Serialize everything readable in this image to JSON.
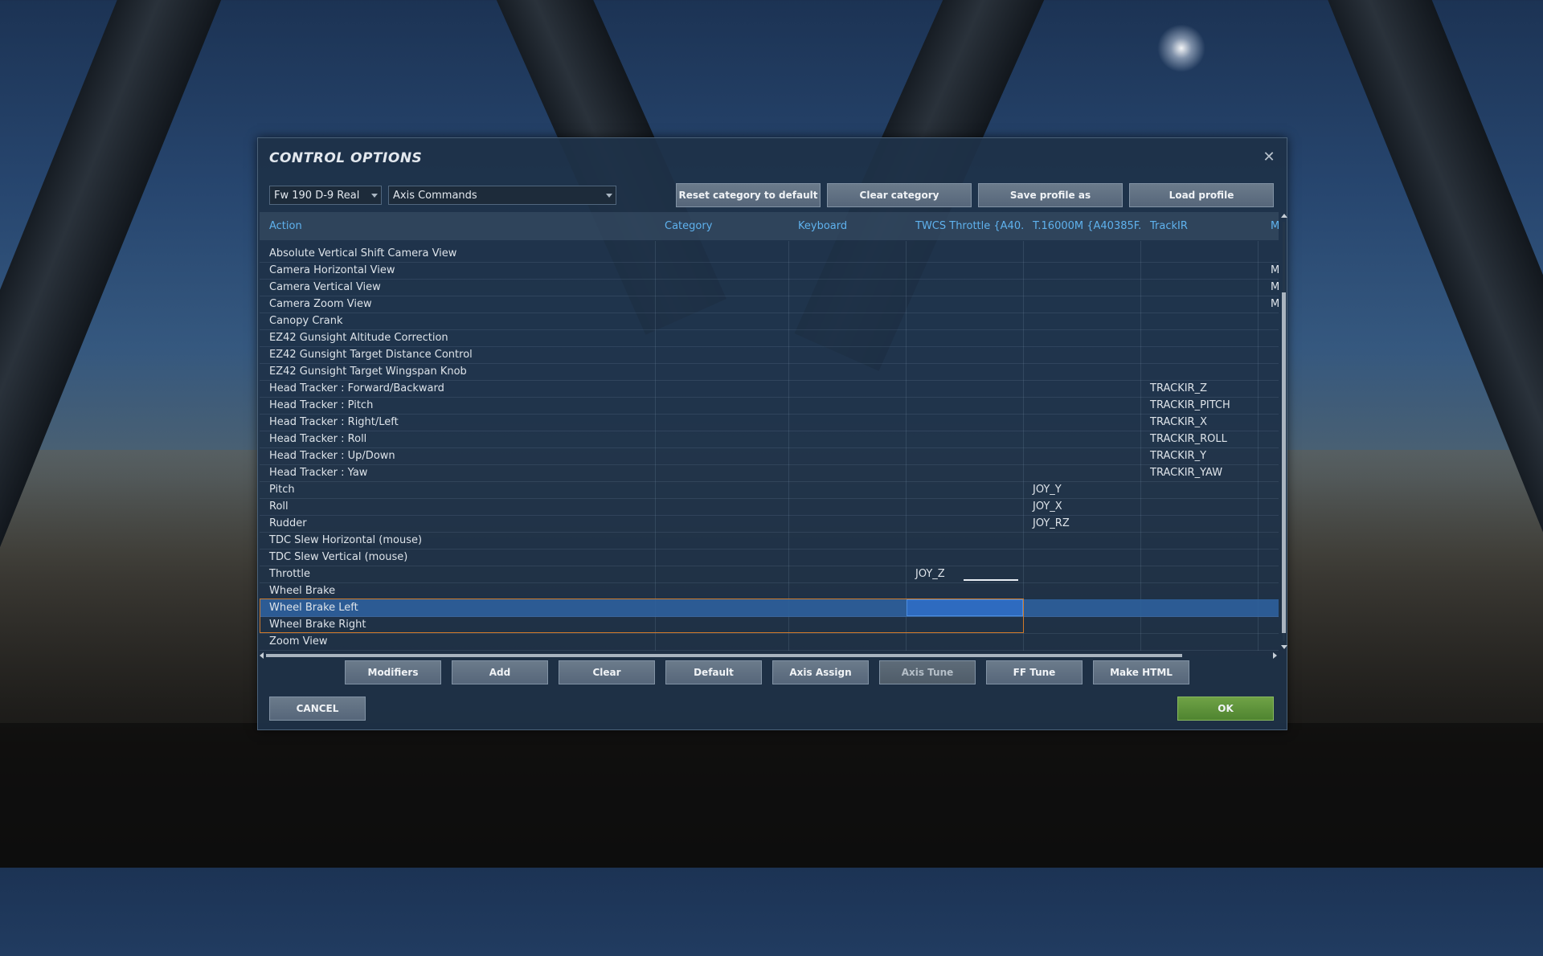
{
  "dialog": {
    "title": "CONTROL OPTIONS",
    "close_icon": "close-icon"
  },
  "selectors": {
    "aircraft": "Fw 190 D-9 Real",
    "category": "Axis Commands"
  },
  "top_buttons": {
    "reset": "Reset category to default",
    "clear_category": "Clear category",
    "save_profile": "Save profile as",
    "load_profile": "Load profile"
  },
  "columns": {
    "action": "Action",
    "category": "Category",
    "keyboard": "Keyboard",
    "twcs": "TWCS Throttle {A40...",
    "t16000m": "T.16000M {A40385F...",
    "trackir": "TrackIR",
    "more": "M"
  },
  "rows": [
    {
      "action": "Absolute Vertical Shift Camera View",
      "twcs": "",
      "t16000m": "",
      "trackir": "",
      "more": ""
    },
    {
      "action": "Camera Horizontal View",
      "twcs": "",
      "t16000m": "",
      "trackir": "",
      "more": "M"
    },
    {
      "action": "Camera Vertical View",
      "twcs": "",
      "t16000m": "",
      "trackir": "",
      "more": "M"
    },
    {
      "action": "Camera Zoom View",
      "twcs": "",
      "t16000m": "",
      "trackir": "",
      "more": "M"
    },
    {
      "action": "Canopy Crank",
      "twcs": "",
      "t16000m": "",
      "trackir": "",
      "more": ""
    },
    {
      "action": "EZ42 Gunsight Altitude Correction",
      "twcs": "",
      "t16000m": "",
      "trackir": "",
      "more": ""
    },
    {
      "action": "EZ42 Gunsight Target Distance Control",
      "twcs": "",
      "t16000m": "",
      "trackir": "",
      "more": ""
    },
    {
      "action": "EZ42 Gunsight Target Wingspan Knob",
      "twcs": "",
      "t16000m": "",
      "trackir": "",
      "more": ""
    },
    {
      "action": "Head Tracker : Forward/Backward",
      "twcs": "",
      "t16000m": "",
      "trackir": "TRACKIR_Z",
      "more": ""
    },
    {
      "action": "Head Tracker : Pitch",
      "twcs": "",
      "t16000m": "",
      "trackir": "TRACKIR_PITCH",
      "more": ""
    },
    {
      "action": "Head Tracker : Right/Left",
      "twcs": "",
      "t16000m": "",
      "trackir": "TRACKIR_X",
      "more": ""
    },
    {
      "action": "Head Tracker : Roll",
      "twcs": "",
      "t16000m": "",
      "trackir": "TRACKIR_ROLL",
      "more": ""
    },
    {
      "action": "Head Tracker : Up/Down",
      "twcs": "",
      "t16000m": "",
      "trackir": "TRACKIR_Y",
      "more": ""
    },
    {
      "action": "Head Tracker : Yaw",
      "twcs": "",
      "t16000m": "",
      "trackir": "TRACKIR_YAW",
      "more": ""
    },
    {
      "action": "Pitch",
      "twcs": "",
      "t16000m": "JOY_Y",
      "trackir": "",
      "more": ""
    },
    {
      "action": "Roll",
      "twcs": "",
      "t16000m": "JOY_X",
      "trackir": "",
      "more": ""
    },
    {
      "action": "Rudder",
      "twcs": "",
      "t16000m": "JOY_RZ",
      "trackir": "",
      "more": ""
    },
    {
      "action": "TDC Slew Horizontal (mouse)",
      "twcs": "",
      "t16000m": "",
      "trackir": "",
      "more": ""
    },
    {
      "action": "TDC Slew Vertical (mouse)",
      "twcs": "",
      "t16000m": "",
      "trackir": "",
      "more": ""
    },
    {
      "action": "Throttle",
      "twcs": "JOY_Z",
      "t16000m": "",
      "trackir": "",
      "more": ""
    },
    {
      "action": "Wheel Brake",
      "twcs": "",
      "t16000m": "",
      "trackir": "",
      "more": ""
    },
    {
      "action": "Wheel Brake Left",
      "twcs": "",
      "t16000m": "",
      "trackir": "",
      "more": ""
    },
    {
      "action": "Wheel Brake Right",
      "twcs": "",
      "t16000m": "",
      "trackir": "",
      "more": ""
    },
    {
      "action": "Zoom View",
      "twcs": "",
      "t16000m": "",
      "trackir": "",
      "more": ""
    }
  ],
  "selected_row": "Wheel Brake Left",
  "bottom_buttons": {
    "modifiers": "Modifiers",
    "add": "Add",
    "clear": "Clear",
    "default": "Default",
    "axis_assign": "Axis Assign",
    "axis_tune": "Axis Tune",
    "ff_tune": "FF Tune",
    "make_html": "Make HTML"
  },
  "footer": {
    "cancel": "CANCEL",
    "ok": "OK"
  },
  "colors": {
    "header_text": "#5fb2ee",
    "selection_border": "#d07a2a",
    "selected_row": "#2e609c",
    "ok_button": "#5f9a3b"
  }
}
